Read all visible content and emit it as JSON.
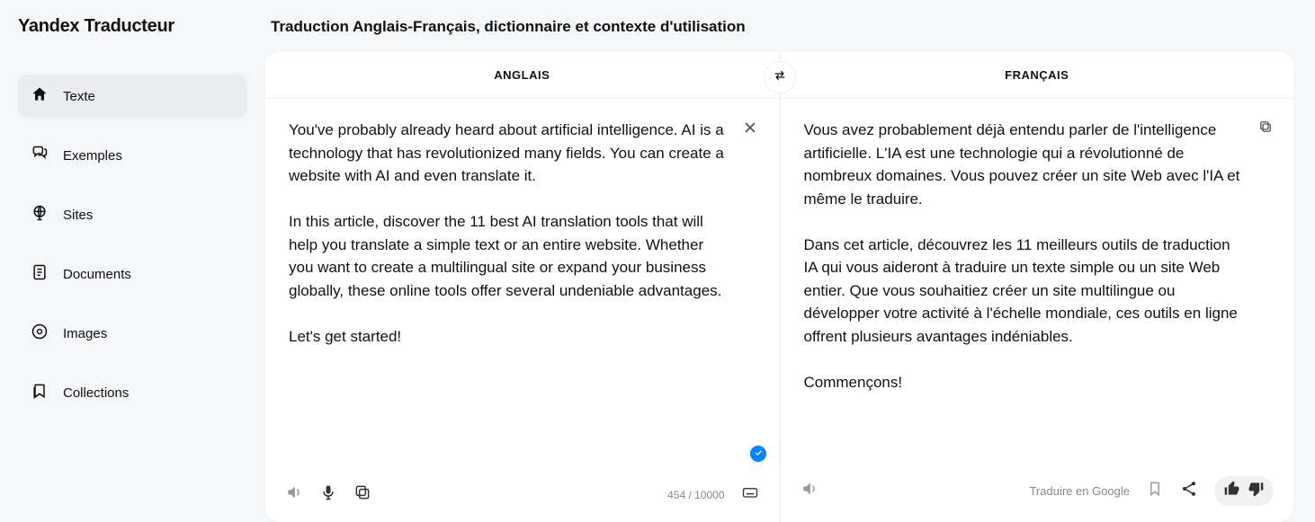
{
  "logo": "Yandex Traducteur",
  "nav": [
    {
      "key": "texte",
      "label": "Texte",
      "active": true
    },
    {
      "key": "exemples",
      "label": "Exemples",
      "active": false
    },
    {
      "key": "sites",
      "label": "Sites",
      "active": false
    },
    {
      "key": "documents",
      "label": "Documents",
      "active": false
    },
    {
      "key": "images",
      "label": "Images",
      "active": false
    },
    {
      "key": "collections",
      "label": "Collections",
      "active": false
    }
  ],
  "page_title": "Traduction Anglais-Français, dictionnaire et contexte d'utilisation",
  "source": {
    "lang_label": "ANGLAIS",
    "text": "You've probably already heard about artificial intelligence. AI is a technology that has revolutionized many fields. You can create a website with AI and even translate it.\n\nIn this article, discover the 11 best AI translation tools that will help you translate a simple text or an entire website. Whether you want to create a multilingual site or expand your business globally, these online tools offer several undeniable advantages.\n\nLet's get started!",
    "char_count": "454 / 10000"
  },
  "target": {
    "lang_label": "FRANÇAIS",
    "text": "Vous avez probablement déjà entendu parler de l'intelligence artificielle. L'IA est une technologie qui a révolutionné de nombreux domaines. Vous pouvez créer un site Web avec l'IA et même le traduire.\n\nDans cet article, découvrez les 11 meilleurs outils de traduction IA qui vous aideront à traduire un texte simple ou un site Web entier. Que vous souhaitiez créer un site multilingue ou développer votre activité à l'échelle mondiale, ces outils en ligne offrent plusieurs avantages indéniables.\n\nCommençons!",
    "external_link": "Traduire en Google"
  }
}
